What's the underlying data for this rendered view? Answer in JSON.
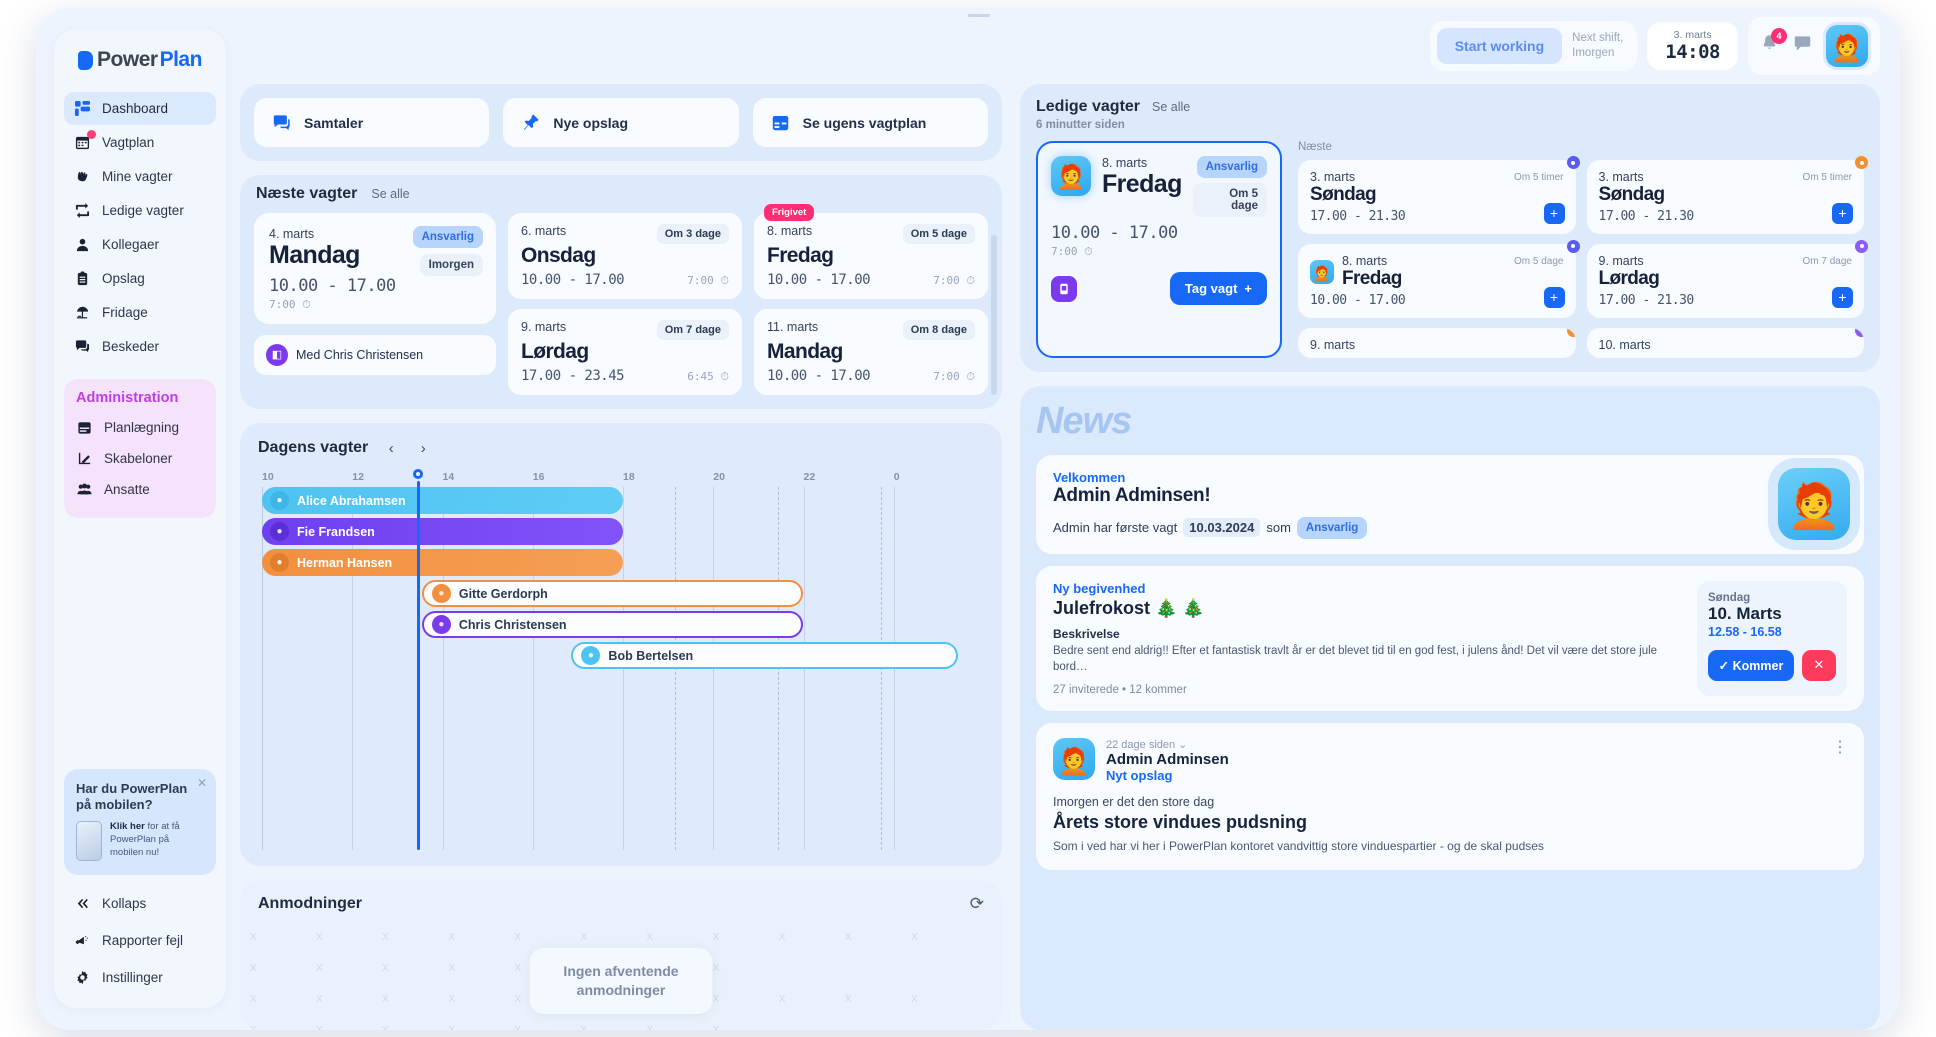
{
  "brand": {
    "part1": "Power",
    "part2": "Plan"
  },
  "sidebar": {
    "items": [
      {
        "label": "Dashboard",
        "icon": "grid-icon"
      },
      {
        "label": "Vagtplan",
        "icon": "calendar-icon"
      },
      {
        "label": "Mine vagter",
        "icon": "hand-icon"
      },
      {
        "label": "Ledige vagter",
        "icon": "swap-icon"
      },
      {
        "label": "Kollegaer",
        "icon": "person-icon"
      },
      {
        "label": "Opslag",
        "icon": "clipboard-icon"
      },
      {
        "label": "Fridage",
        "icon": "beach-icon"
      },
      {
        "label": "Beskeder",
        "icon": "chat-icon"
      }
    ],
    "admin": {
      "title": "Administration",
      "items": [
        {
          "label": "Planlægning",
          "icon": "calendar-icon"
        },
        {
          "label": "Skabeloner",
          "icon": "template-icon"
        },
        {
          "label": "Ansatte",
          "icon": "people-icon"
        }
      ]
    },
    "promo": {
      "title": "Har du PowerPlan på mobilen?",
      "link": "Klik her",
      "text": " for at få PowerPlan på mobilen nu!"
    },
    "footer": [
      {
        "label": "Kollaps",
        "icon": "collapse-icon"
      },
      {
        "label": "Rapporter fejl",
        "icon": "megaphone-icon"
      },
      {
        "label": "Instillinger",
        "icon": "gear-icon"
      }
    ]
  },
  "topbar": {
    "start_label": "Start working",
    "next_shift_line1": "Next shift,",
    "next_shift_line2": "Imorgen",
    "clock_date": "3. marts",
    "clock_time": "14:08",
    "notification_count": "4"
  },
  "quick_actions": [
    {
      "label": "Samtaler",
      "icon": "chat-icon"
    },
    {
      "label": "Nye opslag",
      "icon": "pin-icon"
    },
    {
      "label": "Se ugens vagtplan",
      "icon": "calendar-icon"
    }
  ],
  "next_shifts": {
    "title": "Næste vagter",
    "see_all": "Se alle",
    "featured": {
      "date": "4. marts",
      "day": "Mandag",
      "time": "10.00 - 17.00",
      "duration": "7:00",
      "tag_role": "Ansvarlig",
      "tag_when": "Imorgen",
      "with_label": "Med Chris Christensen"
    },
    "cards": [
      {
        "date": "6. marts",
        "day": "Onsdag",
        "time": "10.00 - 17.00",
        "duration": "7:00",
        "when": "Om 3 dage",
        "ribbon": ""
      },
      {
        "date": "8. marts",
        "day": "Fredag",
        "time": "10.00 - 17.00",
        "duration": "7:00",
        "when": "Om 5 dage",
        "ribbon": "Frigivet"
      },
      {
        "date": "9. marts",
        "day": "Lørdag",
        "time": "17.00 - 23.45",
        "duration": "6:45",
        "when": "Om 7 dage",
        "ribbon": ""
      },
      {
        "date": "11. marts",
        "day": "Mandag",
        "time": "10.00 - 17.00",
        "duration": "7:00",
        "when": "Om 8 dage",
        "ribbon": ""
      }
    ]
  },
  "open_shifts": {
    "title": "Ledige vagter",
    "see_all": "Se alle",
    "updated": "6 minutter siden",
    "featured": {
      "date": "8. marts",
      "day": "Fredag",
      "time": "10.00 - 17.00",
      "duration": "7:00",
      "tag_role": "Ansvarlig",
      "tag_when": "Om 5 dage",
      "take_label": "Tag vagt"
    },
    "next_label": "Næste",
    "cards": [
      {
        "date": "3. marts",
        "day": "Søndag",
        "time": "17.00 - 21.30",
        "when": "Om 5 timer",
        "avatar": false,
        "dot": "cd-blue"
      },
      {
        "date": "3. marts",
        "day": "Søndag",
        "time": "17.00 - 21.30",
        "when": "Om 5 timer",
        "avatar": false,
        "dot": "cd-orange"
      },
      {
        "date": "8. marts",
        "day": "Fredag",
        "time": "10.00 - 17.00",
        "when": "Om 5 dage",
        "avatar": true,
        "dot": "cd-blue"
      },
      {
        "date": "9. marts",
        "day": "Lørdag",
        "time": "17.00 - 21.30",
        "when": "Om 7 dage",
        "avatar": false,
        "dot": "cd-violet"
      },
      {
        "date": "9. marts",
        "day": "",
        "time": "",
        "when": "",
        "avatar": false,
        "dot": "cd-orange"
      },
      {
        "date": "10. marts",
        "day": "",
        "time": "",
        "when": "",
        "avatar": false,
        "dot": "cd-violet"
      }
    ]
  },
  "gantt": {
    "title": "Dagens vagter",
    "ticks": [
      "10",
      "12",
      "14",
      "16",
      "18",
      "20",
      "22",
      "0"
    ],
    "now_hour": 13.0,
    "rows": [
      {
        "name": "Alice Abrahamsen",
        "start": 10.0,
        "end": 17.0,
        "style": "filled",
        "color": "#4fc3f0",
        "color2": "#5ecdf6",
        "avatar_bg": "#3fb6e8"
      },
      {
        "name": "Fie Frandsen",
        "start": 10.0,
        "end": 17.0,
        "style": "filled",
        "color": "#6d3ff0",
        "color2": "#8253f8",
        "avatar_bg": "#5c2fd6"
      },
      {
        "name": "Herman Hansen",
        "start": 10.0,
        "end": 17.0,
        "style": "filled",
        "color": "#f2903f",
        "color2": "#f59f56",
        "avatar_bg": "#e07f2e"
      },
      {
        "name": "Gitte Gerdorph",
        "start": 13.1,
        "end": 20.5,
        "style": "outline",
        "color": "#f2903f",
        "color2": "#f2903f",
        "avatar_bg": "#f2903f"
      },
      {
        "name": "Chris Christensen",
        "start": 13.1,
        "end": 20.5,
        "style": "outline",
        "color": "#7c3aed",
        "color2": "#7c3aed",
        "avatar_bg": "#7c3aed"
      },
      {
        "name": "Bob Bertelsen",
        "start": 16.0,
        "end": 23.5,
        "style": "outline",
        "color": "#4fc3f0",
        "color2": "#4fc3f0",
        "avatar_bg": "#4fc3f0"
      }
    ]
  },
  "requests": {
    "title": "Anmodninger",
    "empty_line1": "Ingen afventende",
    "empty_line2": "anmodninger"
  },
  "news": {
    "title": "News",
    "welcome": {
      "kicker": "Velkommen",
      "heading": "Admin Adminsen!",
      "text_before": "Admin har første vagt",
      "date": "10.03.2024",
      "text_mid": "som",
      "tag": "Ansvarlig"
    },
    "event": {
      "kicker": "Ny begivenhed",
      "heading": "Julefrokost 🎄 🎄",
      "desc_label": "Beskrivelse",
      "desc": "Bedre sent end aldrig!! Efter et fantastisk travlt år er det blevet tid til en god fest, i julens ånd! Det vil være det store jule bord…",
      "meta": "27 inviterede • 12 kommer",
      "day": "Søndag",
      "date": "10. Marts",
      "time": "12.58 - 16.58",
      "accept": "✓  Kommer",
      "decline": "✕"
    },
    "post": {
      "time": "22 dage siden",
      "author": "Admin Adminsen",
      "kicker": "Nyt opslag",
      "lead": "Imorgen er det den store dag",
      "heading": "Årets store vindues pudsning",
      "body": "Som i ved har vi her i PowerPlan kontoret vandvittig store vinduespartier - og de skal pudses"
    }
  }
}
